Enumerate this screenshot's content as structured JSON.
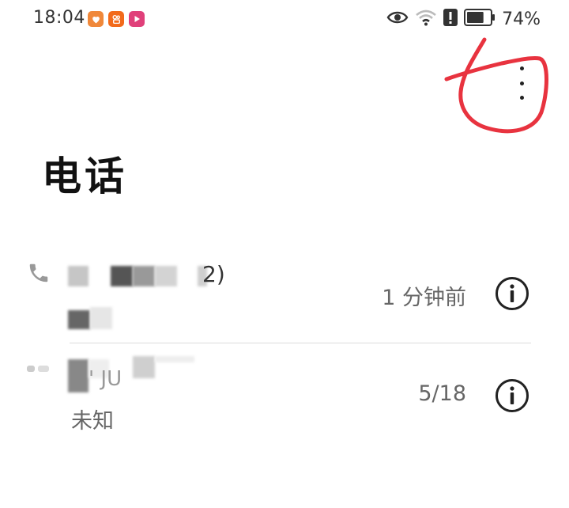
{
  "status_bar": {
    "time": "18:04",
    "battery_percent": "74%",
    "battery_level": 0.74,
    "app_icons": [
      {
        "name": "heart-app-icon",
        "color": "#f0883a"
      },
      {
        "name": "kuaishou-app-icon",
        "color": "#f26a1b"
      },
      {
        "name": "video-app-icon",
        "color": "#e0407a"
      }
    ],
    "icons": [
      "eye-icon",
      "wifi-icon",
      "alert-icon",
      "battery-icon"
    ]
  },
  "header": {
    "title": "电话",
    "menu_icon": "more-vert-icon"
  },
  "call_log": [
    {
      "number_partial": "2)",
      "time": "1 分钟前",
      "call_type_icon": "phone-incoming-icon",
      "info_icon": "info-icon"
    },
    {
      "number_partial": "' JU",
      "subtitle": "未知",
      "time": "5/18",
      "call_type_icon": "phone-outgoing-icon",
      "info_icon": "info-icon"
    }
  ],
  "colors": {
    "annotation": "#e8333f",
    "text_primary": "#111111",
    "text_secondary": "#666666",
    "divider": "#dcdcdc"
  }
}
